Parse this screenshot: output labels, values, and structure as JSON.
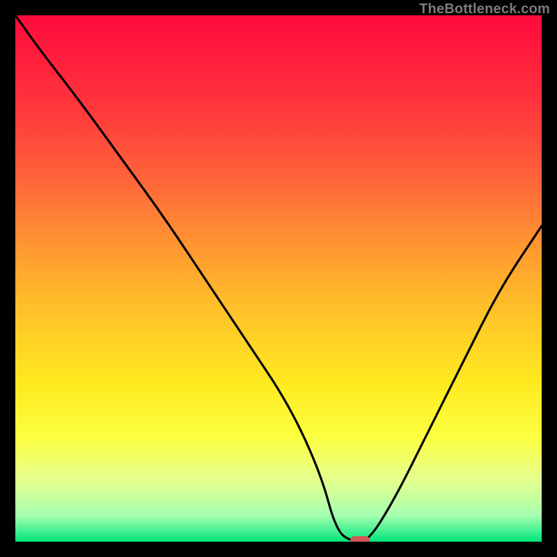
{
  "attribution": "TheBottleneck.com",
  "chart_data": {
    "type": "line",
    "title": "",
    "xlabel": "",
    "ylabel": "",
    "xlim": [
      0,
      100
    ],
    "ylim": [
      0,
      100
    ],
    "background_gradient": [
      {
        "pos": 0.0,
        "color": "#ff0a3c"
      },
      {
        "pos": 0.15,
        "color": "#ff2f3c"
      },
      {
        "pos": 0.3,
        "color": "#ff603a"
      },
      {
        "pos": 0.45,
        "color": "#ff9b30"
      },
      {
        "pos": 0.58,
        "color": "#ffc828"
      },
      {
        "pos": 0.7,
        "color": "#ffea20"
      },
      {
        "pos": 0.8,
        "color": "#fcff40"
      },
      {
        "pos": 0.88,
        "color": "#e6ff8c"
      },
      {
        "pos": 0.95,
        "color": "#a6ffb0"
      },
      {
        "pos": 1.0,
        "color": "#00e57a"
      }
    ],
    "series": [
      {
        "name": "bottleneck-curve",
        "x": [
          0,
          5,
          12,
          20,
          28,
          36,
          44,
          52,
          58,
          61,
          64,
          67,
          72,
          78,
          85,
          92,
          100
        ],
        "y": [
          100,
          93,
          84,
          73,
          62,
          50,
          38,
          26,
          13,
          2,
          0,
          0,
          8,
          20,
          34,
          48,
          60
        ]
      }
    ],
    "marker": {
      "name": "optimal-point",
      "x": 65.5,
      "y": 0,
      "color": "#cf5a5a"
    }
  }
}
